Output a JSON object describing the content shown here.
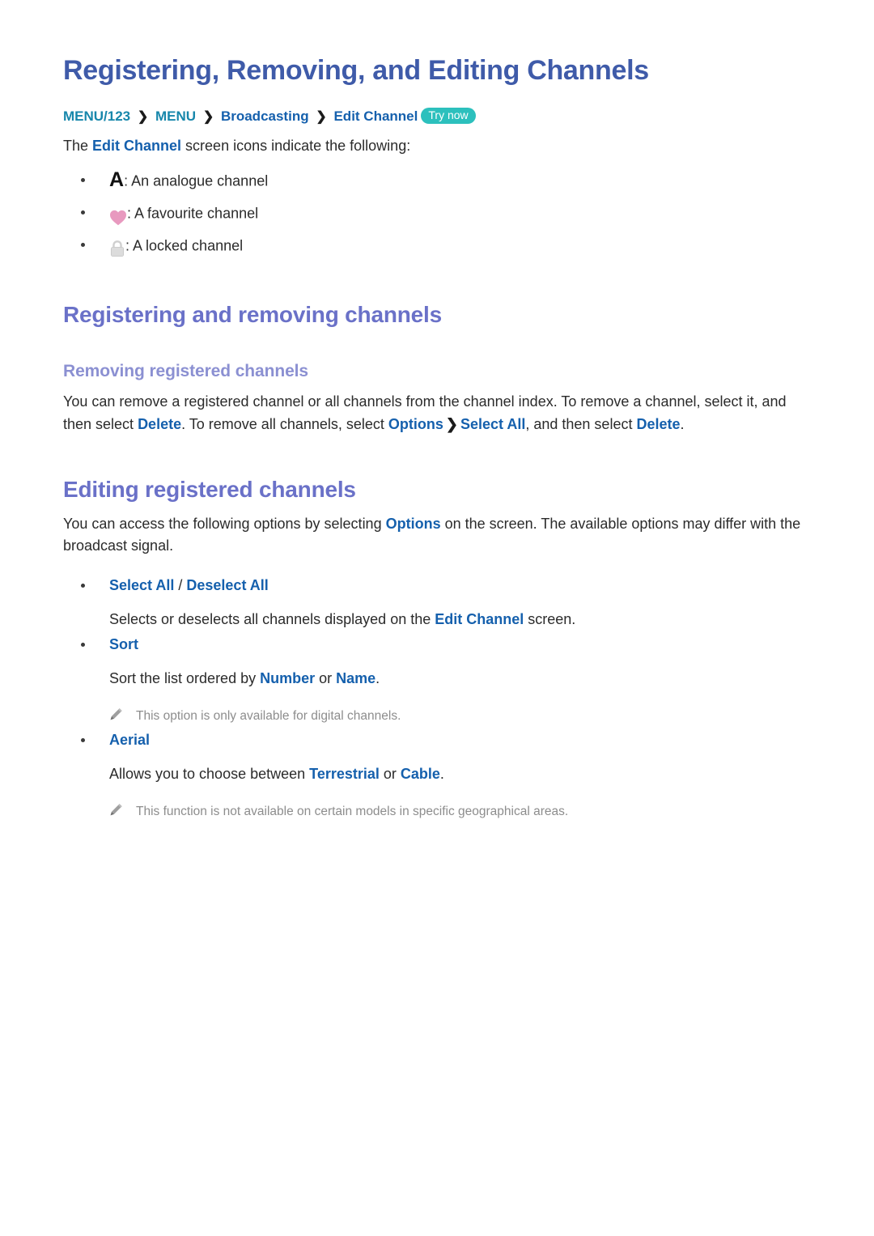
{
  "page": {
    "title": "Registering, Removing, and Editing Channels"
  },
  "breadcrumb": {
    "items": [
      {
        "label": "MENU/123",
        "style": "teal"
      },
      {
        "label": "MENU",
        "style": "teal"
      },
      {
        "label": "Broadcasting",
        "style": "blue"
      },
      {
        "label": "Edit Channel",
        "style": "blue"
      }
    ],
    "separator": "❯",
    "badge": "Try now"
  },
  "intro": {
    "before": "The ",
    "link": "Edit Channel",
    "after": " screen icons indicate the following:"
  },
  "icon_list": [
    {
      "icon": "letter-a-icon",
      "glyph": "A",
      "text": ": An analogue channel"
    },
    {
      "icon": "heart-icon",
      "glyph": "",
      "text": ": A favourite channel"
    },
    {
      "icon": "lock-icon",
      "glyph": "",
      "text": ": A locked channel"
    }
  ],
  "sections": [
    {
      "heading": "Registering and removing channels",
      "subheading": "Removing registered channels",
      "paragraph": {
        "p1": "You can remove a registered channel or all channels from the channel index. To remove a channel, select it, and then select ",
        "l1": "Delete",
        "p2": ". To remove all channels, select ",
        "l2": "Options",
        "sep": "❯",
        "l3": "Select All",
        "p3": ", and then select ",
        "l4": "Delete",
        "p4": "."
      }
    },
    {
      "heading": "Editing registered channels",
      "paragraph": {
        "p1": "You can access the following options by selecting ",
        "l1": "Options",
        "p2": " on the screen. The available options may differ with the broadcast signal."
      }
    }
  ],
  "options": [
    {
      "name": "select-all",
      "label_a": "Select All",
      "slash": " / ",
      "label_b": "Deselect All",
      "desc_p1": "Selects or deselects all channels displayed on the ",
      "desc_l1": "Edit Channel",
      "desc_p2": " screen.",
      "note": null
    },
    {
      "name": "sort",
      "label_a": "Sort",
      "slash": "",
      "label_b": "",
      "desc_p1": "Sort the list ordered by ",
      "desc_l1": "Number",
      "desc_p2": " or ",
      "desc_l2": "Name",
      "desc_p3": ".",
      "note": "This option is only available for digital channels."
    },
    {
      "name": "aerial",
      "label_a": "Aerial",
      "slash": "",
      "label_b": "",
      "desc_p1": "Allows you to choose between ",
      "desc_l1": "Terrestrial",
      "desc_p2": " or ",
      "desc_l2": "Cable",
      "desc_p3": ".",
      "note": "This function is not available on certain models in specific geographical areas."
    }
  ],
  "colors": {
    "title": "#3f5ba9",
    "section_heading": "#6a71c8",
    "sub_heading": "#8b90d2",
    "link_blue": "#1560ad",
    "breadcrumb_teal": "#1787ab",
    "badge_teal": "#2cc0bd",
    "heart_pink": "#e899bf",
    "lock_gray": "#d7d7d7",
    "note_gray": "#8d8d8d",
    "body": "#2b2b2b"
  }
}
